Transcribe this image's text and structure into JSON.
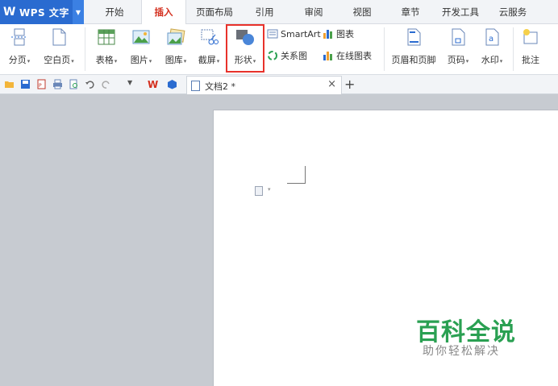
{
  "app": {
    "logo": "W",
    "name": "WPS 文字",
    "drop": "▼"
  },
  "menu_tabs": [
    {
      "label": "开始",
      "active": false
    },
    {
      "label": "插入",
      "active": true
    },
    {
      "label": "页面布局",
      "active": false
    },
    {
      "label": "引用",
      "active": false
    },
    {
      "label": "审阅",
      "active": false
    },
    {
      "label": "视图",
      "active": false
    },
    {
      "label": "章节",
      "active": false
    },
    {
      "label": "开发工具",
      "active": false
    },
    {
      "label": "云服务",
      "active": false
    }
  ],
  "ribbon": {
    "page_break": "分页",
    "blank_page": "空白页",
    "table": "表格",
    "picture": "图片",
    "gallery": "图库",
    "screenshot": "截屏",
    "shape": "形状",
    "smartart": "SmartArt",
    "chart": "图表",
    "relation": "关系图",
    "online_chart": "在线图表",
    "header_footer": "页眉和页脚",
    "page_number": "页码",
    "watermark": "水印",
    "comment": "批注",
    "dropdown_caret": "▾"
  },
  "doc_tab": {
    "title": "文档2 *",
    "close": "×",
    "new_tab": "+"
  },
  "watermark": {
    "title": "百科全说",
    "subtitle": "助你轻松解决"
  },
  "colors": {
    "accent": "#2a6bd0",
    "active_tab": "#d4301f",
    "highlight": "#e8322b",
    "watermark": "#2aa052"
  }
}
